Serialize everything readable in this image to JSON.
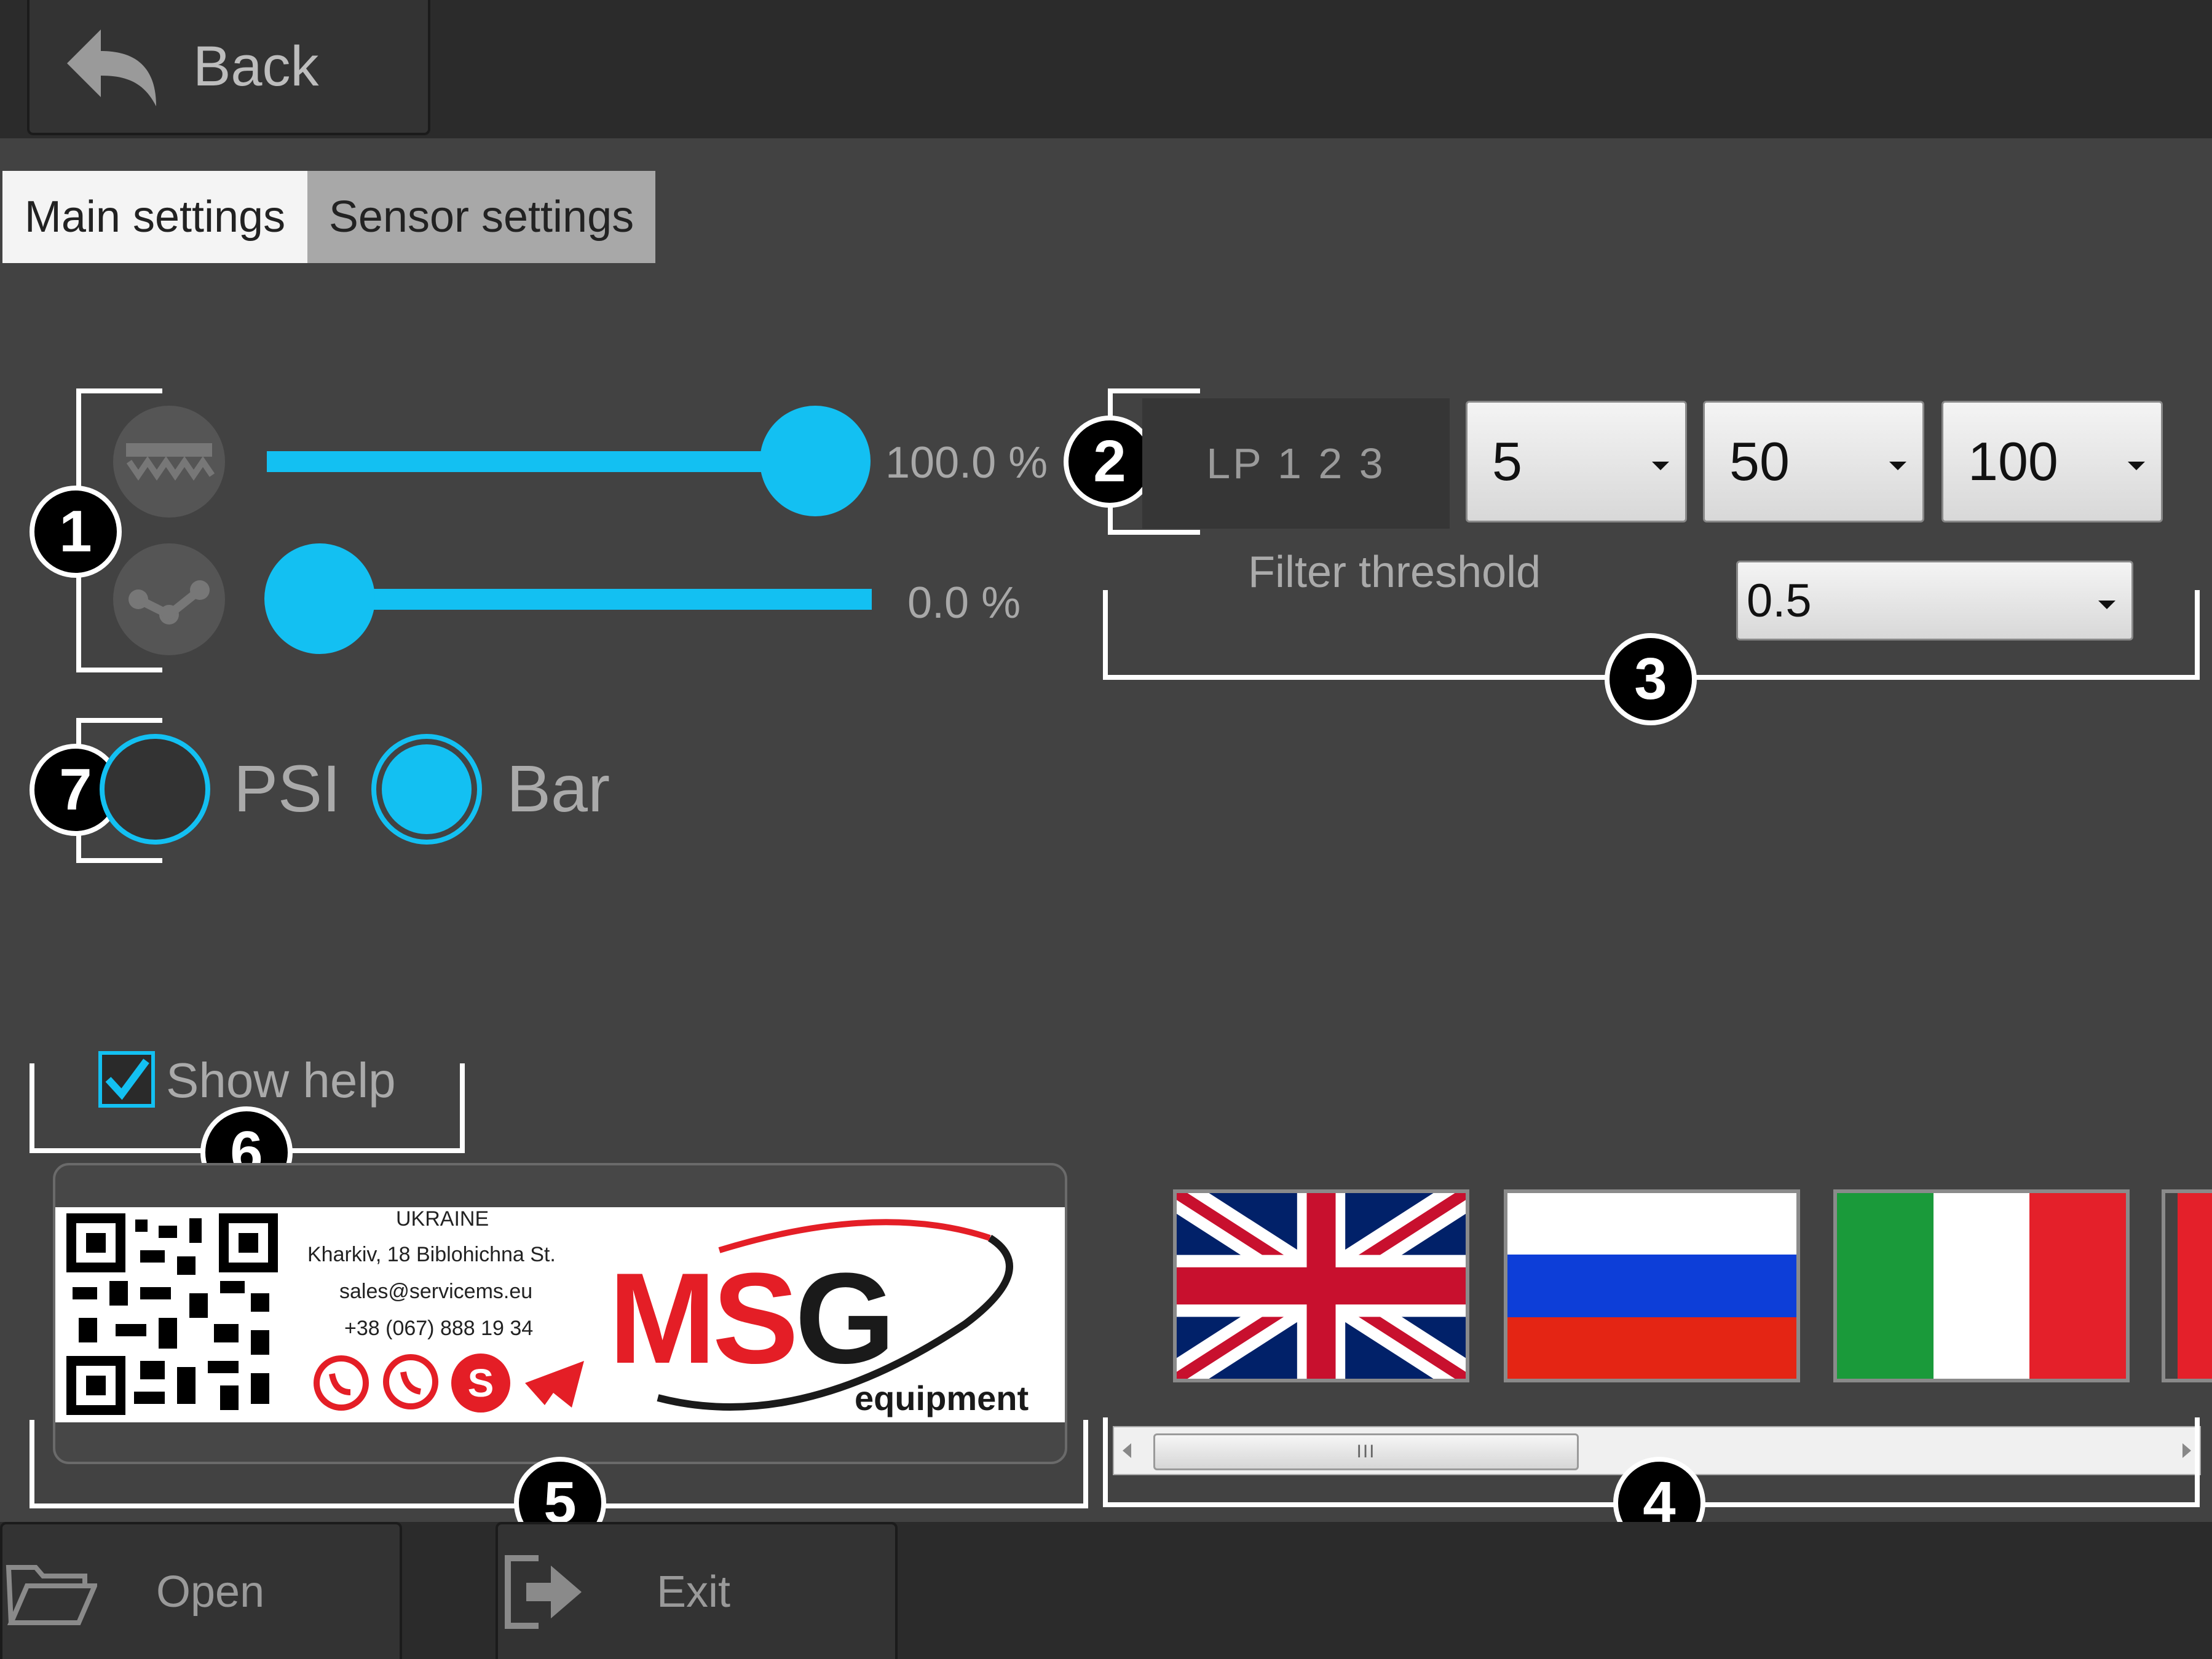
{
  "topbar": {
    "back_label": "Back"
  },
  "tabs": [
    {
      "label": "Main settings",
      "active": true
    },
    {
      "label": "Sensor settings",
      "active": false
    }
  ],
  "sliders": [
    {
      "icon": "belt-icon",
      "value_percent": 100.0,
      "label": "100.0 %"
    },
    {
      "icon": "chain-icon",
      "value_percent": 0.0,
      "label": "0.0 %"
    }
  ],
  "lowpass": {
    "label": "LP 1 2 3",
    "values": [
      "5",
      "50",
      "100"
    ]
  },
  "filter": {
    "label": "Filter threshold",
    "value": "0.5"
  },
  "units": {
    "options": [
      {
        "label": "PSI",
        "selected": false
      },
      {
        "label": "Bar",
        "selected": true
      }
    ]
  },
  "help": {
    "label": "Show help",
    "checked": true
  },
  "info": {
    "country": "UKRAINE",
    "address": "Kharkiv, 18 Biblohichna St.",
    "email": "sales@servicems.eu",
    "phone": "+38 (067) 888 19 34",
    "logo_main": "MS",
    "logo_g": "G",
    "logo_sub": "equipment",
    "social_icons": [
      "whatsapp-icon",
      "viber-icon",
      "skype-icon",
      "telegram-icon"
    ]
  },
  "languages": [
    "uk-flag",
    "russia-flag",
    "italy-flag",
    "partial-flag"
  ],
  "scrollbar": {
    "thumb_grip": "III"
  },
  "callouts": [
    "1",
    "2",
    "3",
    "4",
    "5",
    "6",
    "7"
  ],
  "bottombar": {
    "open_label": "Open",
    "exit_label": "Exit"
  },
  "colors": {
    "accent": "#13c0f2",
    "background": "#424242",
    "bar": "#2b2b2b"
  }
}
